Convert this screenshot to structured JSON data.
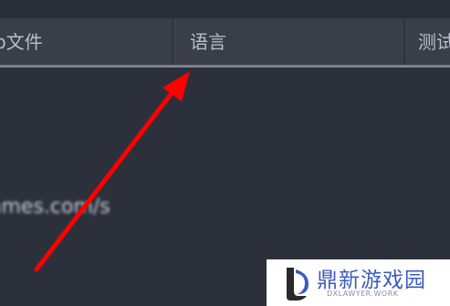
{
  "tabs": {
    "file_label": "文件",
    "file_icon_glyph": "p",
    "language_label": "语言",
    "test_label": "测试"
  },
  "content": {
    "url_text": "ames.com/s"
  },
  "watermark": {
    "title": "鼎新游戏园",
    "subtitle": "DXLAWYER.WORK"
  },
  "colors": {
    "arrow": "#ff0000",
    "background": "#2c303a",
    "tab": "#3a3e48",
    "watermark_blue": "#3c5bbf"
  }
}
